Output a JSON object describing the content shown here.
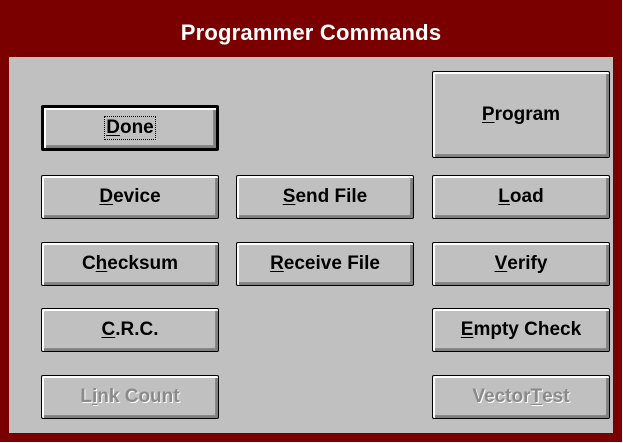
{
  "window": {
    "title": "Programmer Commands",
    "title_bar_color": "#7a0000",
    "face_color": "#c0c0c0"
  },
  "buttons": {
    "done": {
      "pre": "",
      "acc": "D",
      "post": "one",
      "enabled": true,
      "default": true,
      "focused": true
    },
    "device": {
      "pre": "",
      "acc": "D",
      "post": "evice",
      "enabled": true
    },
    "checksum": {
      "pre": "C",
      "acc": "h",
      "post": "ecksum",
      "enabled": true
    },
    "crc": {
      "pre": "",
      "acc": "C",
      "post": ".R.C.",
      "enabled": true
    },
    "link_count": {
      "pre": "L",
      "acc": "i",
      "post": "nk Count",
      "enabled": false
    },
    "send_file": {
      "pre": "",
      "acc": "S",
      "post": "end File",
      "enabled": true
    },
    "receive_file": {
      "pre": "",
      "acc": "R",
      "post": "eceive File",
      "enabled": true
    },
    "program": {
      "pre": "",
      "acc": "P",
      "post": "rogram",
      "enabled": true
    },
    "load": {
      "pre": "",
      "acc": "L",
      "post": "oad",
      "enabled": true
    },
    "verify": {
      "pre": "",
      "acc": "V",
      "post": "erify",
      "enabled": true
    },
    "empty_check": {
      "pre": "",
      "acc": "E",
      "post": "mpty Check",
      "enabled": true
    },
    "vector_test": {
      "pre": "Vector ",
      "acc": "T",
      "post": "est",
      "enabled": false
    }
  }
}
